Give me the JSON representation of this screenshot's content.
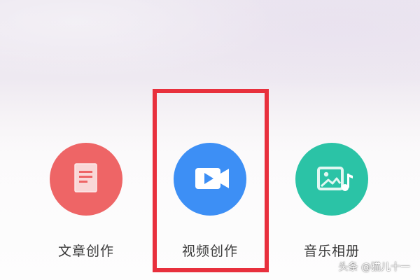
{
  "menu": {
    "items": [
      {
        "id": "article",
        "label": "文章创作",
        "icon": "document-icon",
        "color": "#ee6566"
      },
      {
        "id": "video",
        "label": "视频创作",
        "icon": "video-camera-icon",
        "color": "#3d8ff5"
      },
      {
        "id": "music",
        "label": "音乐相册",
        "icon": "photo-music-icon",
        "color": "#2bc3a6"
      }
    ]
  },
  "annotation": {
    "color": "#e8303d"
  },
  "watermark": {
    "text": "头条 @猫儿十一"
  }
}
